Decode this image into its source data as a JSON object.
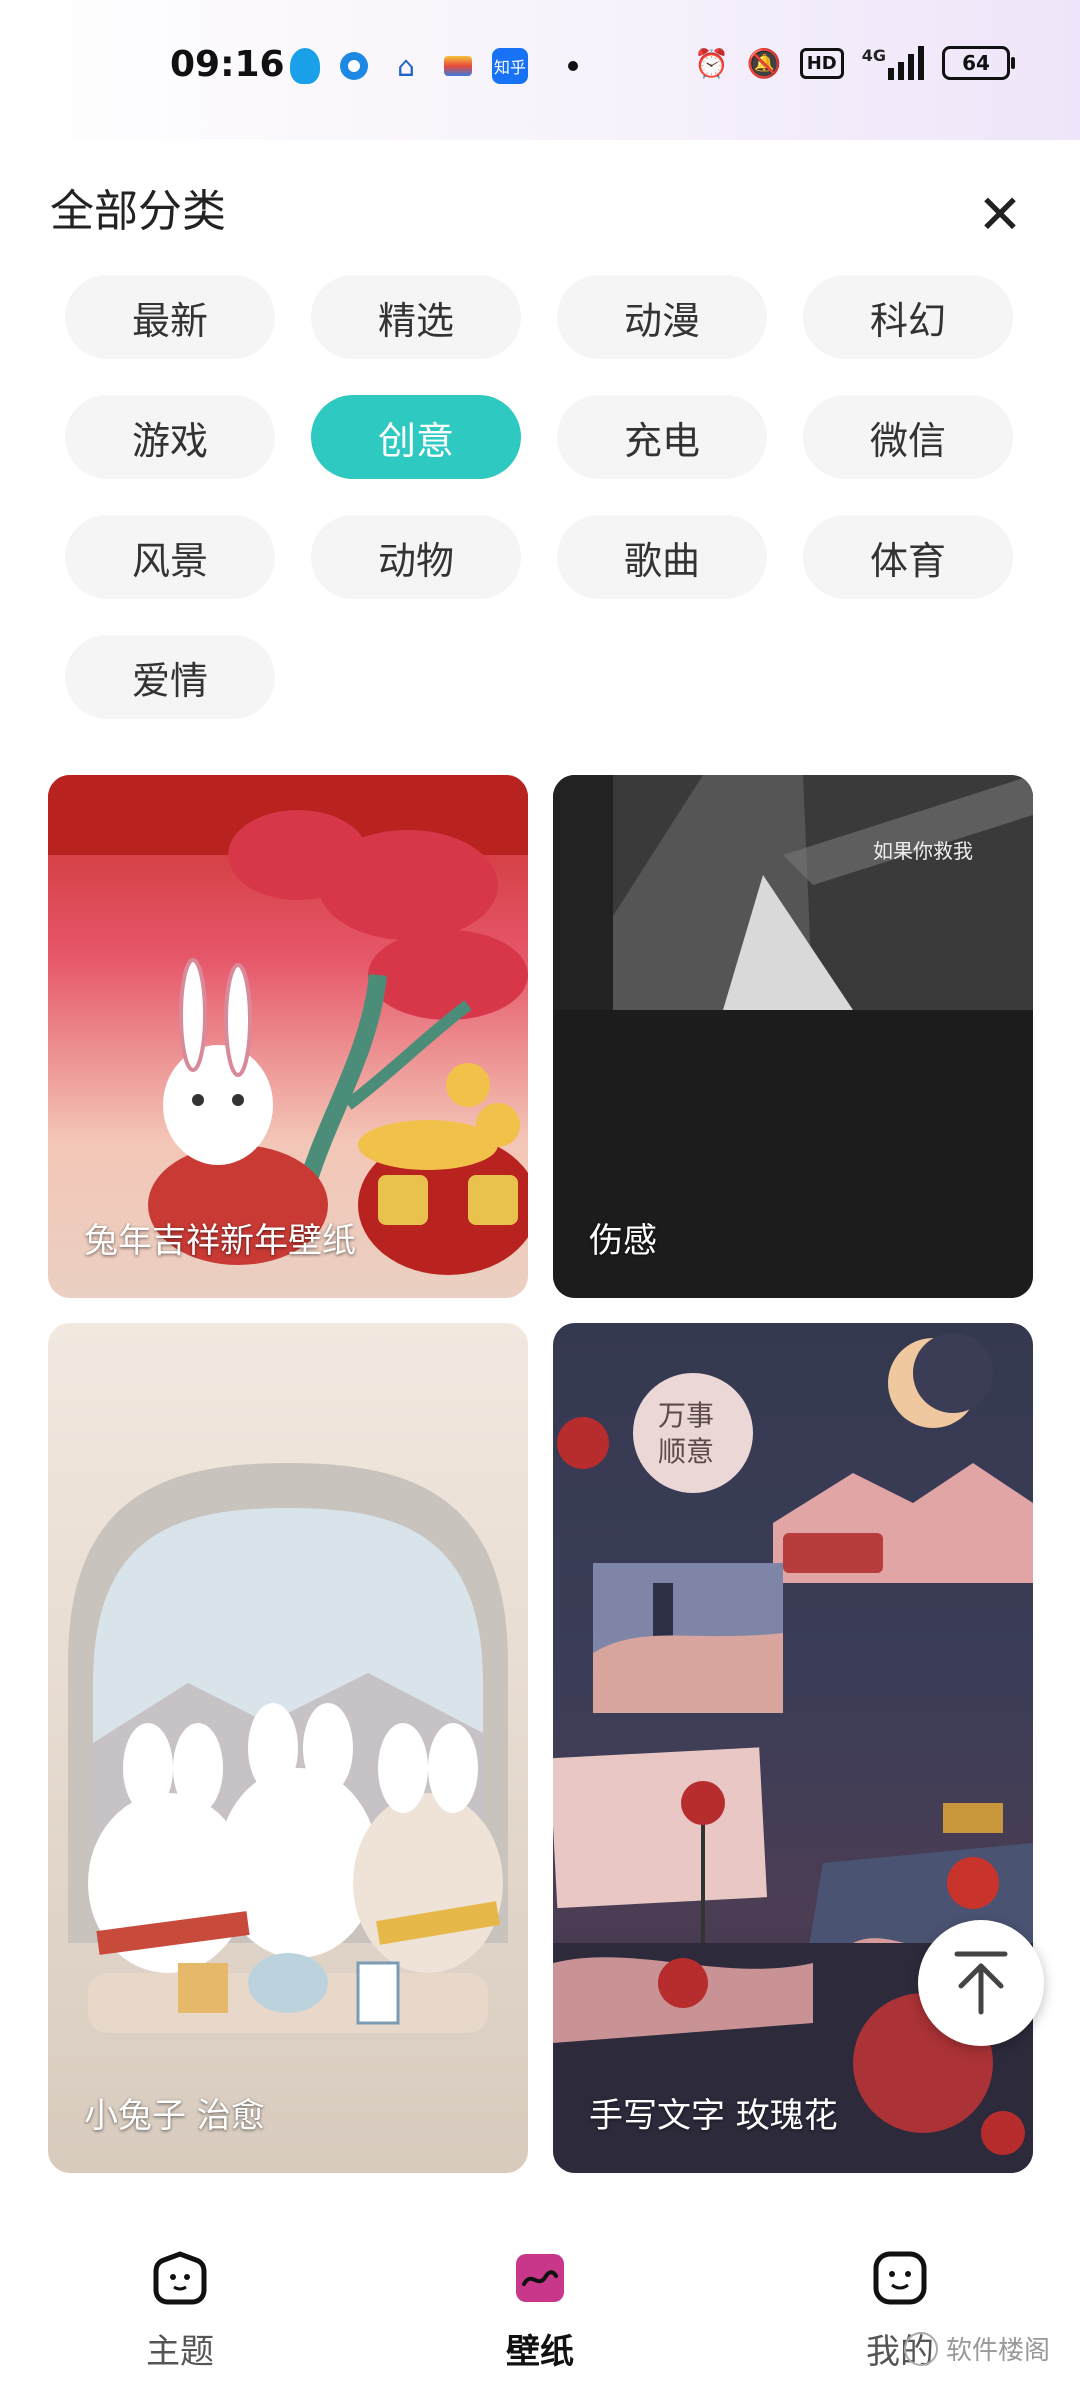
{
  "status_bar": {
    "time": "09:16",
    "hd": "HD",
    "network": "4G",
    "battery": "64",
    "left_icons": [
      "qq-icon",
      "browser-icon",
      "telecom-icon",
      "app-icon",
      "zhihu-icon"
    ],
    "right_icons": [
      "alarm-icon",
      "mute-icon",
      "hd-icon",
      "signal-icon",
      "battery-icon"
    ],
    "zhihu_label": "知乎"
  },
  "header": {
    "title": "全部分类",
    "close_icon": "close-icon"
  },
  "categories": [
    {
      "label": "最新",
      "active": false
    },
    {
      "label": "精选",
      "active": false
    },
    {
      "label": "动漫",
      "active": false
    },
    {
      "label": "科幻",
      "active": false
    },
    {
      "label": "游戏",
      "active": false
    },
    {
      "label": "创意",
      "active": true
    },
    {
      "label": "充电",
      "active": false
    },
    {
      "label": "微信",
      "active": false
    },
    {
      "label": "风景",
      "active": false
    },
    {
      "label": "动物",
      "active": false
    },
    {
      "label": "歌曲",
      "active": false
    },
    {
      "label": "体育",
      "active": false
    },
    {
      "label": "爱情",
      "active": false
    }
  ],
  "wallpapers": [
    {
      "label": "兔年吉祥新年壁纸"
    },
    {
      "label": "伤感",
      "overlay_text": "如果你救我"
    },
    {
      "label": "小兔子 治愈"
    },
    {
      "label": "手写文字 玫瑰花",
      "overlay_text": "万事顺意"
    }
  ],
  "back_to_top_icon": "arrow-up-icon",
  "bottom_nav": [
    {
      "label": "主题",
      "icon": "theme-icon",
      "active": false
    },
    {
      "label": "壁纸",
      "icon": "wallpaper-icon",
      "active": true
    },
    {
      "label": "我的",
      "icon": "profile-icon",
      "active": false
    }
  ],
  "watermark": "软件楼阁",
  "colors": {
    "accent": "#2ec9c0",
    "chip_bg": "#f5f5f5",
    "wallpaper_icon": "#c9378a"
  }
}
